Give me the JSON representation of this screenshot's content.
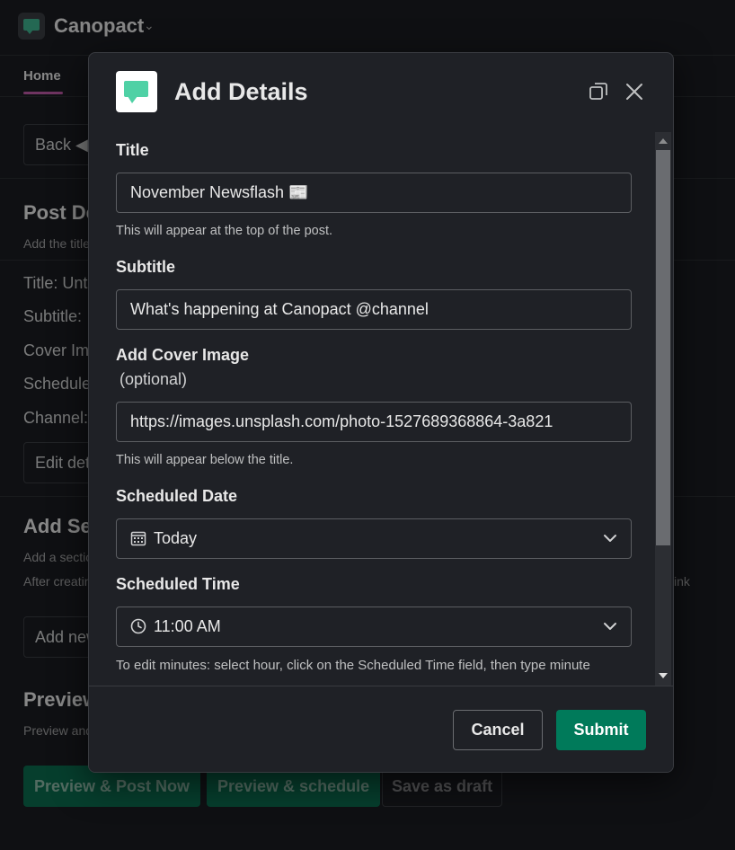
{
  "workspace": {
    "name": "Canopact",
    "tab": "Home"
  },
  "background": {
    "back_button": "Back ◀",
    "post_details_heading": "Post Details",
    "post_details_hint": "Add the title",
    "rows": [
      "Title: Untitled",
      "Subtitle:",
      "Cover Image:",
      "Scheduled:",
      "Channel:"
    ],
    "edit_button": "Edit details",
    "sections_heading": "Add Sections",
    "sections_hint_1": "Add a section",
    "sections_hint_2": "After creating",
    "sections_hint_right": "ink",
    "add_new_button": "Add new",
    "preview_heading": "Preview",
    "preview_hint": "Preview and",
    "preview_post_now": "Preview & Post Now",
    "preview_schedule": "Preview & schedule",
    "save_draft": "Save as draft"
  },
  "modal": {
    "title": "Add Details",
    "fields": {
      "title": {
        "label": "Title",
        "value": "November Newsflash 📰",
        "hint": "This will appear at the top of the post."
      },
      "subtitle": {
        "label": "Subtitle",
        "value": "What's happening at Canopact @channel"
      },
      "cover": {
        "label": "Add Cover Image",
        "optional": "(optional)",
        "value": "https://images.unsplash.com/photo-1527689368864-3a821",
        "hint": "This will appear below the title."
      },
      "date": {
        "label": "Scheduled Date",
        "value": "Today"
      },
      "time": {
        "label": "Scheduled Time",
        "value": "11:00 AM",
        "hint": "To edit minutes: select hour, click on the Scheduled Time field, then type minute"
      }
    },
    "cancel_label": "Cancel",
    "submit_label": "Submit"
  },
  "colors": {
    "accent": "#007a5a",
    "brand_green": "#4fd1a5",
    "background": "#1a1d21",
    "modal": "#1f2126"
  },
  "icons": [
    "workspace-logo-icon",
    "chevron-down-icon",
    "popout-icon",
    "close-icon",
    "calendar-icon",
    "clock-icon"
  ]
}
